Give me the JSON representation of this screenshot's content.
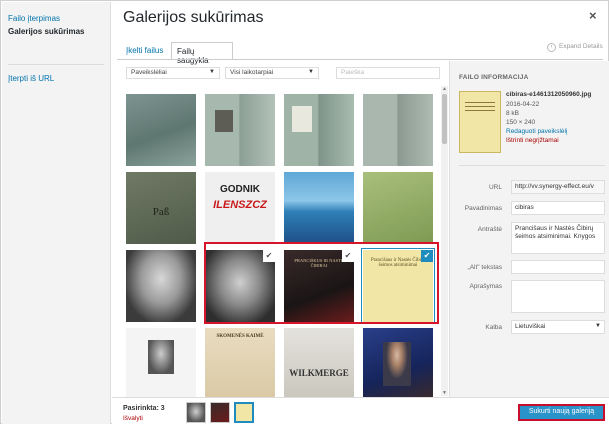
{
  "sidebar": {
    "items": [
      {
        "label": "Failo įterpimas"
      },
      {
        "label": "Galerijos sukūrimas"
      },
      {
        "label": "Įterpti iš URL"
      }
    ]
  },
  "header": {
    "title": "Galerijos sukūrimas",
    "close_icon": "close-icon",
    "tabs": [
      {
        "label": "Įkelti failus"
      },
      {
        "label": "Failų saugykla"
      }
    ],
    "expand_label": "Expand Details"
  },
  "filters": {
    "type_selected": "Paveikslėliai",
    "date_selected": "Visi laikotarpiai",
    "search_placeholder": "Paieška"
  },
  "grid": {
    "tiles": [
      {
        "desc": "passport-page"
      },
      {
        "desc": "passport-photo-page"
      },
      {
        "desc": "passport-stamp-page"
      },
      {
        "desc": "passport-text-page"
      },
      {
        "desc": "pass-cover",
        "text": "Paß"
      },
      {
        "desc": "newspaper",
        "text": "GODNIK",
        "text2": "ILENSZCZ"
      },
      {
        "desc": "landscape-photo"
      },
      {
        "desc": "green-book-cover"
      },
      {
        "desc": "portrait-man"
      },
      {
        "desc": "portrait-elder-glasses",
        "selected": true
      },
      {
        "desc": "dark-book-cover",
        "text": "PRANCIŠKUS IR NASTĖ ČIBIRAI",
        "selected": true
      },
      {
        "desc": "yellow-book-cover",
        "text": "Prancišaus ir Nastės Čibirų šeimos atsiminimai",
        "selected": true,
        "current": true
      },
      {
        "desc": "small-portrait"
      },
      {
        "desc": "old-newspaper",
        "text": "SKOMENĖS KAIMĖ"
      },
      {
        "desc": "wilkmerge-book",
        "text": "WILKMERGE"
      },
      {
        "desc": "man-blue-background"
      }
    ]
  },
  "details": {
    "section_title": "FAILO INFORMACIJA",
    "filename": "cibiras-e1461312050960.jpg",
    "date": "2016-04-22",
    "size": "8 kB",
    "dimensions": "150 × 240",
    "edit_link": "Redaguoti paveikslėlį",
    "delete_link": "Ištrinti negrįžtamai",
    "fields": {
      "url_label": "URL",
      "url_value": "http://vv.synergy-effect.eu/v",
      "title_label": "Pavadinimas",
      "title_value": "cibiras",
      "caption_label": "Antraštė",
      "caption_value": "Prancišaus ir Nastės Čibirų šeimos atsiminimai. Knygos",
      "alt_label": "„Alt\" tekstas",
      "alt_value": "",
      "description_label": "Aprašymas",
      "description_value": "",
      "language_label": "Kalba",
      "language_value": "Lietuviškai"
    }
  },
  "footer": {
    "selected_count": "Pasirinkta: 3",
    "clear_link": "Išvalyti",
    "create_button": "Sukurti naują galeriją"
  }
}
